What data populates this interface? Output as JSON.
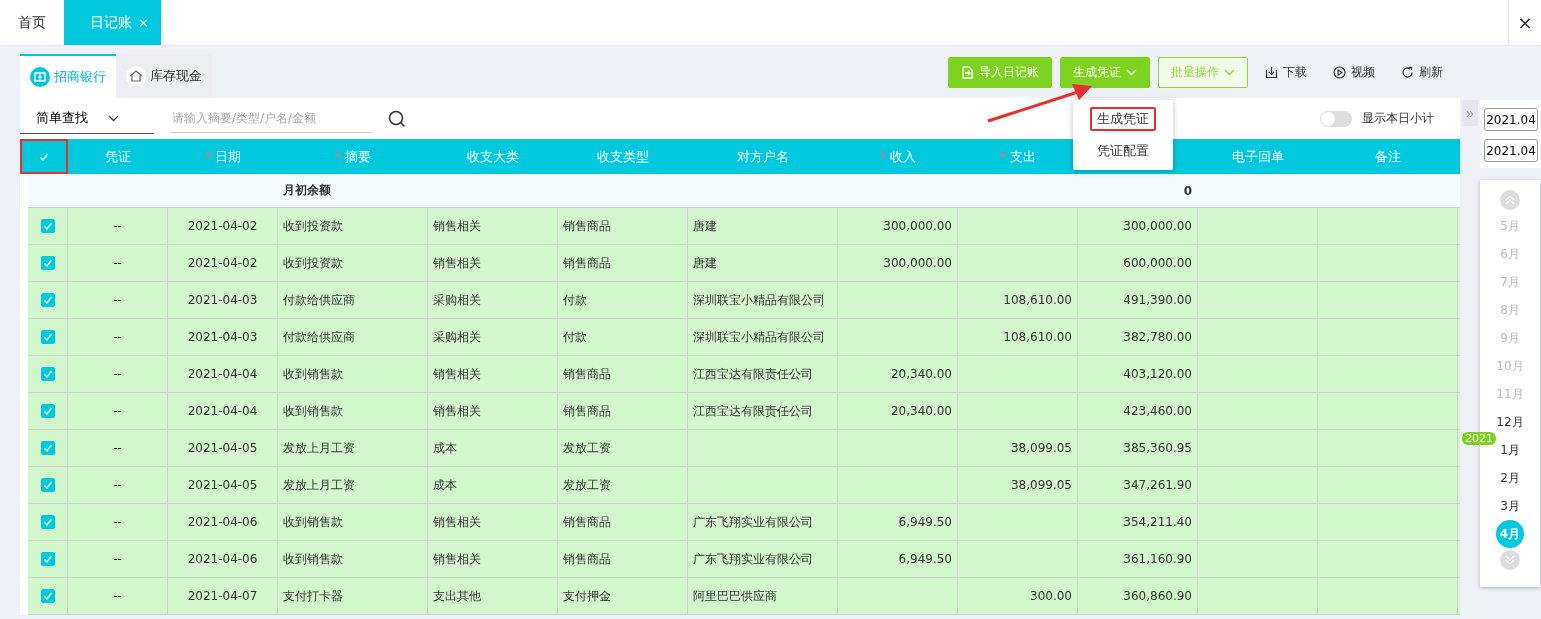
{
  "top_tabs": [
    {
      "label": "首页",
      "selected": false,
      "closable": false
    },
    {
      "label": "日记账",
      "selected": true,
      "closable": true
    }
  ],
  "close_symbol": "×",
  "accounts": [
    {
      "label": "招商银行",
      "selected": true
    },
    {
      "label": "库存现金",
      "selected": false
    }
  ],
  "actions": [
    {
      "label": "导入日记账",
      "kind": "primary",
      "caret": false
    },
    {
      "label": "生成凭证",
      "kind": "primary",
      "caret": true
    },
    {
      "label": "批量操作",
      "kind": "outline",
      "caret": true
    },
    {
      "label": "下载",
      "kind": "link",
      "caret": false
    },
    {
      "label": "视频",
      "kind": "link",
      "caret": false
    },
    {
      "label": "刷新",
      "kind": "link",
      "caret": false
    }
  ],
  "dropdown": {
    "items": [
      {
        "label": "生成凭证",
        "marked": true
      },
      {
        "label": "凭证配置",
        "marked": false
      }
    ]
  },
  "search": {
    "mode": "简单查找",
    "placeholder": "请输入摘要/类型/户名/金额"
  },
  "daily_subtotal": {
    "label": "显示本日小计",
    "on": false
  },
  "table": {
    "required_mark": "*",
    "header_checked": true,
    "header_marked": true,
    "columns": [
      {
        "label": "凭证",
        "required": false
      },
      {
        "label": "日期",
        "required": true
      },
      {
        "label": "摘要",
        "required": true
      },
      {
        "label": "收支大类",
        "required": false
      },
      {
        "label": "收支类型",
        "required": false
      },
      {
        "label": "对方户名",
        "required": false
      },
      {
        "label": "收入",
        "required": true
      },
      {
        "label": "支出",
        "required": true
      },
      {
        "required": false
      },
      {
        "label": "电子回单",
        "required": false
      },
      {
        "label": "备注",
        "required": false
      }
    ],
    "opening": {
      "summary": "月初余额",
      "balance": "0"
    },
    "rows": [
      {
        "checked": true,
        "voucher": "--",
        "date": "2021-04-02",
        "summary": "收到投资款",
        "category": "销售相关",
        "type": "销售商品",
        "counterparty": "唐建",
        "income": "300,000.00",
        "balance": "300,000.00"
      },
      {
        "checked": true,
        "voucher": "--",
        "date": "2021-04-02",
        "summary": "收到投资款",
        "category": "销售相关",
        "type": "销售商品",
        "counterparty": "唐建",
        "income": "300,000.00",
        "balance": "600,000.00"
      },
      {
        "checked": true,
        "voucher": "--",
        "date": "2021-04-03",
        "summary": "付款给供应商",
        "category": "采购相关",
        "type": "付款",
        "counterparty": "深圳联宝小精品有限公司",
        "expense": "108,610.00",
        "balance": "491,390.00"
      },
      {
        "checked": true,
        "voucher": "--",
        "date": "2021-04-03",
        "summary": "付款给供应商",
        "category": "采购相关",
        "type": "付款",
        "counterparty": "深圳联宝小精品有限公司",
        "expense": "108,610.00",
        "balance": "382,780.00"
      },
      {
        "checked": true,
        "voucher": "--",
        "date": "2021-04-04",
        "summary": "收到销售款",
        "category": "销售相关",
        "type": "销售商品",
        "counterparty": "江西宝达有限责任公司",
        "income": "20,340.00",
        "balance": "403,120.00"
      },
      {
        "checked": true,
        "voucher": "--",
        "date": "2021-04-04",
        "summary": "收到销售款",
        "category": "销售相关",
        "type": "销售商品",
        "counterparty": "江西宝达有限责任公司",
        "income": "20,340.00",
        "balance": "423,460.00"
      },
      {
        "checked": true,
        "voucher": "--",
        "date": "2021-04-05",
        "summary": "发放上月工资",
        "category": "成本",
        "type": "发放工资",
        "expense": "38,099.05",
        "balance": "385,360.95"
      },
      {
        "checked": true,
        "voucher": "--",
        "date": "2021-04-05",
        "summary": "发放上月工资",
        "category": "成本",
        "type": "发放工资",
        "expense": "38,099.05",
        "balance": "347,261.90"
      },
      {
        "checked": true,
        "voucher": "--",
        "date": "2021-04-06",
        "summary": "收到销售款",
        "category": "销售相关",
        "type": "销售商品",
        "counterparty": "广东飞翔实业有限公司",
        "income": "6,949.50",
        "balance": "354,211.40"
      },
      {
        "checked": true,
        "voucher": "--",
        "date": "2021-04-06",
        "summary": "收到销售款",
        "category": "销售相关",
        "type": "销售商品",
        "counterparty": "广东飞翔实业有限公司",
        "income": "6,949.50",
        "balance": "361,160.90"
      },
      {
        "checked": true,
        "voucher": "--",
        "date": "2021-04-07",
        "summary": "支付打卡器",
        "category": "支出其他",
        "type": "支付押金",
        "counterparty": "阿里巴巴供应商",
        "expense": "300.00",
        "balance": "360,860.90"
      }
    ]
  },
  "period": {
    "collapse_symbol": "»",
    "from": "2021.04",
    "to": "2021.04",
    "year_badge": "2021",
    "months": [
      {
        "label": "5月",
        "disabled": true,
        "selected": false
      },
      {
        "label": "6月",
        "disabled": true,
        "selected": false
      },
      {
        "label": "7月",
        "disabled": true,
        "selected": false
      },
      {
        "label": "8月",
        "disabled": true,
        "selected": false
      },
      {
        "label": "9月",
        "disabled": true,
        "selected": false
      },
      {
        "label": "10月",
        "disabled": true,
        "selected": false
      },
      {
        "label": "11月",
        "disabled": true,
        "selected": false
      },
      {
        "label": "12月",
        "disabled": false,
        "selected": false
      },
      {
        "label": "1月",
        "disabled": false,
        "selected": false
      },
      {
        "label": "2月",
        "disabled": false,
        "selected": false
      },
      {
        "label": "3月",
        "disabled": false,
        "selected": false
      },
      {
        "label": "4月",
        "disabled": false,
        "selected": true
      }
    ]
  }
}
